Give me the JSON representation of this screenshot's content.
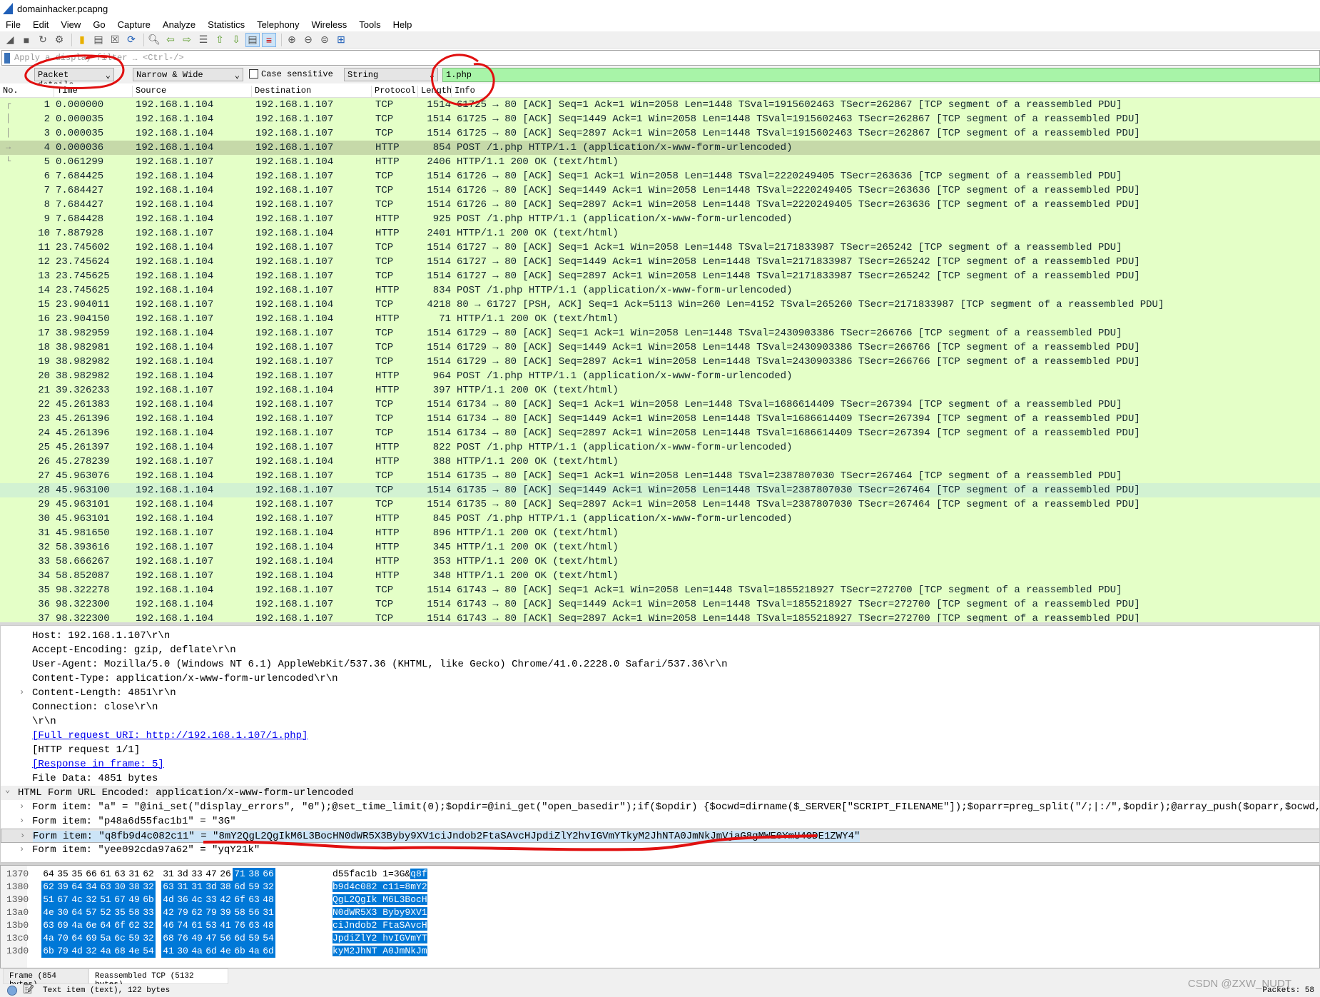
{
  "window": {
    "title": "domainhacker.pcapng"
  },
  "menu": [
    "File",
    "Edit",
    "View",
    "Go",
    "Capture",
    "Analyze",
    "Statistics",
    "Telephony",
    "Wireless",
    "Tools",
    "Help"
  ],
  "toolbar_icons": [
    "shark-fin-start-icon",
    "stop-icon",
    "restart-icon",
    "capture-options-icon",
    "open-file-icon",
    "save-file-icon",
    "close-file-icon",
    "reload-icon",
    "find-packet-icon",
    "go-back-icon",
    "go-forward-icon",
    "go-to-packet-icon",
    "go-first-icon",
    "go-last-icon",
    "autoscroll-icon",
    "colorize-icon",
    "zoom-in-icon",
    "zoom-out-icon",
    "zoom-normal-icon",
    "resize-columns-icon"
  ],
  "filter": {
    "placeholder": "Apply a display filter … <Ctrl-/>"
  },
  "find": {
    "search_in": "Packet details",
    "charset": "Narrow & Wide",
    "case_sensitive_label": "Case sensitive",
    "case_sensitive": false,
    "type": "String",
    "value": "1.php"
  },
  "columns": [
    "No.",
    "Time",
    "Source",
    "Destination",
    "Protocol",
    "Length",
    "Info"
  ],
  "packets": [
    {
      "no": "1",
      "time": "0.000000",
      "src": "192.168.1.104",
      "dst": "192.168.1.107",
      "proto": "TCP",
      "len": "1514",
      "info": "61725 → 80 [ACK] Seq=1 Ack=1 Win=2058 Len=1448 TSval=1915602463 TSecr=262867 [TCP segment of a reassembled PDU]"
    },
    {
      "no": "2",
      "time": "0.000035",
      "src": "192.168.1.104",
      "dst": "192.168.1.107",
      "proto": "TCP",
      "len": "1514",
      "info": "61725 → 80 [ACK] Seq=1449 Ack=1 Win=2058 Len=1448 TSval=1915602463 TSecr=262867 [TCP segment of a reassembled PDU]"
    },
    {
      "no": "3",
      "time": "0.000035",
      "src": "192.168.1.104",
      "dst": "192.168.1.107",
      "proto": "TCP",
      "len": "1514",
      "info": "61725 → 80 [ACK] Seq=2897 Ack=1 Win=2058 Len=1448 TSval=1915602463 TSecr=262867 [TCP segment of a reassembled PDU]"
    },
    {
      "no": "4",
      "time": "0.000036",
      "src": "192.168.1.104",
      "dst": "192.168.1.107",
      "proto": "HTTP",
      "len": "854",
      "info": "POST /1.php HTTP/1.1  (application/x-www-form-urlencoded)",
      "state": "selected"
    },
    {
      "no": "5",
      "time": "0.061299",
      "src": "192.168.1.107",
      "dst": "192.168.1.104",
      "proto": "HTTP",
      "len": "2406",
      "info": "HTTP/1.1 200 OK  (text/html)"
    },
    {
      "no": "6",
      "time": "7.684425",
      "src": "192.168.1.104",
      "dst": "192.168.1.107",
      "proto": "TCP",
      "len": "1514",
      "info": "61726 → 80 [ACK] Seq=1 Ack=1 Win=2058 Len=1448 TSval=2220249405 TSecr=263636 [TCP segment of a reassembled PDU]"
    },
    {
      "no": "7",
      "time": "7.684427",
      "src": "192.168.1.104",
      "dst": "192.168.1.107",
      "proto": "TCP",
      "len": "1514",
      "info": "61726 → 80 [ACK] Seq=1449 Ack=1 Win=2058 Len=1448 TSval=2220249405 TSecr=263636 [TCP segment of a reassembled PDU]"
    },
    {
      "no": "8",
      "time": "7.684427",
      "src": "192.168.1.104",
      "dst": "192.168.1.107",
      "proto": "TCP",
      "len": "1514",
      "info": "61726 → 80 [ACK] Seq=2897 Ack=1 Win=2058 Len=1448 TSval=2220249405 TSecr=263636 [TCP segment of a reassembled PDU]"
    },
    {
      "no": "9",
      "time": "7.684428",
      "src": "192.168.1.104",
      "dst": "192.168.1.107",
      "proto": "HTTP",
      "len": "925",
      "info": "POST /1.php HTTP/1.1  (application/x-www-form-urlencoded)"
    },
    {
      "no": "10",
      "time": "7.887928",
      "src": "192.168.1.107",
      "dst": "192.168.1.104",
      "proto": "HTTP",
      "len": "2401",
      "info": "HTTP/1.1 200 OK  (text/html)"
    },
    {
      "no": "11",
      "time": "23.745602",
      "src": "192.168.1.104",
      "dst": "192.168.1.107",
      "proto": "TCP",
      "len": "1514",
      "info": "61727 → 80 [ACK] Seq=1 Ack=1 Win=2058 Len=1448 TSval=2171833987 TSecr=265242 [TCP segment of a reassembled PDU]"
    },
    {
      "no": "12",
      "time": "23.745624",
      "src": "192.168.1.104",
      "dst": "192.168.1.107",
      "proto": "TCP",
      "len": "1514",
      "info": "61727 → 80 [ACK] Seq=1449 Ack=1 Win=2058 Len=1448 TSval=2171833987 TSecr=265242 [TCP segment of a reassembled PDU]"
    },
    {
      "no": "13",
      "time": "23.745625",
      "src": "192.168.1.104",
      "dst": "192.168.1.107",
      "proto": "TCP",
      "len": "1514",
      "info": "61727 → 80 [ACK] Seq=2897 Ack=1 Win=2058 Len=1448 TSval=2171833987 TSecr=265242 [TCP segment of a reassembled PDU]"
    },
    {
      "no": "14",
      "time": "23.745625",
      "src": "192.168.1.104",
      "dst": "192.168.1.107",
      "proto": "HTTP",
      "len": "834",
      "info": "POST /1.php HTTP/1.1  (application/x-www-form-urlencoded)"
    },
    {
      "no": "15",
      "time": "23.904011",
      "src": "192.168.1.107",
      "dst": "192.168.1.104",
      "proto": "TCP",
      "len": "4218",
      "info": "80 → 61727 [PSH, ACK] Seq=1 Ack=5113 Win=260 Len=4152 TSval=265260 TSecr=2171833987 [TCP segment of a reassembled PDU]"
    },
    {
      "no": "16",
      "time": "23.904150",
      "src": "192.168.1.107",
      "dst": "192.168.1.104",
      "proto": "HTTP",
      "len": "71",
      "info": "HTTP/1.1 200 OK  (text/html)"
    },
    {
      "no": "17",
      "time": "38.982959",
      "src": "192.168.1.104",
      "dst": "192.168.1.107",
      "proto": "TCP",
      "len": "1514",
      "info": "61729 → 80 [ACK] Seq=1 Ack=1 Win=2058 Len=1448 TSval=2430903386 TSecr=266766 [TCP segment of a reassembled PDU]"
    },
    {
      "no": "18",
      "time": "38.982981",
      "src": "192.168.1.104",
      "dst": "192.168.1.107",
      "proto": "TCP",
      "len": "1514",
      "info": "61729 → 80 [ACK] Seq=1449 Ack=1 Win=2058 Len=1448 TSval=2430903386 TSecr=266766 [TCP segment of a reassembled PDU]"
    },
    {
      "no": "19",
      "time": "38.982982",
      "src": "192.168.1.104",
      "dst": "192.168.1.107",
      "proto": "TCP",
      "len": "1514",
      "info": "61729 → 80 [ACK] Seq=2897 Ack=1 Win=2058 Len=1448 TSval=2430903386 TSecr=266766 [TCP segment of a reassembled PDU]"
    },
    {
      "no": "20",
      "time": "38.982982",
      "src": "192.168.1.104",
      "dst": "192.168.1.107",
      "proto": "HTTP",
      "len": "964",
      "info": "POST /1.php HTTP/1.1  (application/x-www-form-urlencoded)"
    },
    {
      "no": "21",
      "time": "39.326233",
      "src": "192.168.1.107",
      "dst": "192.168.1.104",
      "proto": "HTTP",
      "len": "397",
      "info": "HTTP/1.1 200 OK  (text/html)"
    },
    {
      "no": "22",
      "time": "45.261383",
      "src": "192.168.1.104",
      "dst": "192.168.1.107",
      "proto": "TCP",
      "len": "1514",
      "info": "61734 → 80 [ACK] Seq=1 Ack=1 Win=2058 Len=1448 TSval=1686614409 TSecr=267394 [TCP segment of a reassembled PDU]"
    },
    {
      "no": "23",
      "time": "45.261396",
      "src": "192.168.1.104",
      "dst": "192.168.1.107",
      "proto": "TCP",
      "len": "1514",
      "info": "61734 → 80 [ACK] Seq=1449 Ack=1 Win=2058 Len=1448 TSval=1686614409 TSecr=267394 [TCP segment of a reassembled PDU]"
    },
    {
      "no": "24",
      "time": "45.261396",
      "src": "192.168.1.104",
      "dst": "192.168.1.107",
      "proto": "TCP",
      "len": "1514",
      "info": "61734 → 80 [ACK] Seq=2897 Ack=1 Win=2058 Len=1448 TSval=1686614409 TSecr=267394 [TCP segment of a reassembled PDU]"
    },
    {
      "no": "25",
      "time": "45.261397",
      "src": "192.168.1.104",
      "dst": "192.168.1.107",
      "proto": "HTTP",
      "len": "822",
      "info": "POST /1.php HTTP/1.1  (application/x-www-form-urlencoded)"
    },
    {
      "no": "26",
      "time": "45.278239",
      "src": "192.168.1.107",
      "dst": "192.168.1.104",
      "proto": "HTTP",
      "len": "388",
      "info": "HTTP/1.1 200 OK  (text/html)"
    },
    {
      "no": "27",
      "time": "45.963076",
      "src": "192.168.1.104",
      "dst": "192.168.1.107",
      "proto": "TCP",
      "len": "1514",
      "info": "61735 → 80 [ACK] Seq=1 Ack=1 Win=2058 Len=1448 TSval=2387807030 TSecr=267464 [TCP segment of a reassembled PDU]"
    },
    {
      "no": "28",
      "time": "45.963100",
      "src": "192.168.1.104",
      "dst": "192.168.1.107",
      "proto": "TCP",
      "len": "1514",
      "info": "61735 → 80 [ACK] Seq=1449 Ack=1 Win=2058 Len=1448 TSval=2387807030 TSecr=267464 [TCP segment of a reassembled PDU]",
      "state": "hover"
    },
    {
      "no": "29",
      "time": "45.963101",
      "src": "192.168.1.104",
      "dst": "192.168.1.107",
      "proto": "TCP",
      "len": "1514",
      "info": "61735 → 80 [ACK] Seq=2897 Ack=1 Win=2058 Len=1448 TSval=2387807030 TSecr=267464 [TCP segment of a reassembled PDU]"
    },
    {
      "no": "30",
      "time": "45.963101",
      "src": "192.168.1.104",
      "dst": "192.168.1.107",
      "proto": "HTTP",
      "len": "845",
      "info": "POST /1.php HTTP/1.1  (application/x-www-form-urlencoded)"
    },
    {
      "no": "31",
      "time": "45.981650",
      "src": "192.168.1.107",
      "dst": "192.168.1.104",
      "proto": "HTTP",
      "len": "896",
      "info": "HTTP/1.1 200 OK  (text/html)"
    },
    {
      "no": "32",
      "time": "58.393616",
      "src": "192.168.1.107",
      "dst": "192.168.1.104",
      "proto": "HTTP",
      "len": "345",
      "info": "HTTP/1.1 200 OK  (text/html)"
    },
    {
      "no": "33",
      "time": "58.666267",
      "src": "192.168.1.107",
      "dst": "192.168.1.104",
      "proto": "HTTP",
      "len": "353",
      "info": "HTTP/1.1 200 OK  (text/html)"
    },
    {
      "no": "34",
      "time": "58.852087",
      "src": "192.168.1.107",
      "dst": "192.168.1.104",
      "proto": "HTTP",
      "len": "348",
      "info": "HTTP/1.1 200 OK  (text/html)"
    },
    {
      "no": "35",
      "time": "98.322278",
      "src": "192.168.1.104",
      "dst": "192.168.1.107",
      "proto": "TCP",
      "len": "1514",
      "info": "61743 → 80 [ACK] Seq=1 Ack=1 Win=2058 Len=1448 TSval=1855218927 TSecr=272700 [TCP segment of a reassembled PDU]"
    },
    {
      "no": "36",
      "time": "98.322300",
      "src": "192.168.1.104",
      "dst": "192.168.1.107",
      "proto": "TCP",
      "len": "1514",
      "info": "61743 → 80 [ACK] Seq=1449 Ack=1 Win=2058 Len=1448 TSval=1855218927 TSecr=272700 [TCP segment of a reassembled PDU]"
    },
    {
      "no": "37",
      "time": "98.322300",
      "src": "192.168.1.104",
      "dst": "192.168.1.107",
      "proto": "TCP",
      "len": "1514",
      "info": "61743 → 80 [ACK] Seq=2897 Ack=1 Win=2058 Len=1448 TSval=1855218927 TSecr=272700 [TCP segment of a reassembled PDU]"
    }
  ],
  "details": [
    {
      "text": "Host: 192.168.1.107\\r\\n",
      "indent": 1
    },
    {
      "text": "Accept-Encoding: gzip, deflate\\r\\n",
      "indent": 1
    },
    {
      "text": "User-Agent: Mozilla/5.0 (Windows NT 6.1) AppleWebKit/537.36 (KHTML, like Gecko) Chrome/41.0.2228.0 Safari/537.36\\r\\n",
      "indent": 1
    },
    {
      "text": "Content-Type: application/x-www-form-urlencoded\\r\\n",
      "indent": 1
    },
    {
      "text": "Content-Length: 4851\\r\\n",
      "indent": 1,
      "expander": "collapsed"
    },
    {
      "text": "Connection: close\\r\\n",
      "indent": 1
    },
    {
      "text": "\\r\\n",
      "indent": 1
    },
    {
      "text": "[Full request URI: http://192.168.1.107/1.php]",
      "indent": 1,
      "link": true
    },
    {
      "text": "[HTTP request 1/1]",
      "indent": 1
    },
    {
      "text": "[Response in frame: 5]",
      "indent": 1,
      "link": true
    },
    {
      "text": "File Data: 4851 bytes",
      "indent": 1
    },
    {
      "text": "HTML Form URL Encoded: application/x-www-form-urlencoded",
      "indent": 0,
      "expander": "expanded",
      "group": true
    },
    {
      "text": "Form item: \"a\" = \"@ini_set(\"display_errors\", \"0\");@set_time_limit(0);$opdir=@ini_get(\"open_basedir\");if($opdir) {$ocwd=dirname($_SERVER[\"SCRIPT_FILENAME\"]);$oparr=preg_split(\"/;|:/\",$opdir);@array_push($oparr,$ocwd,sys_get_tem",
      "indent": 1,
      "expander": "collapsed"
    },
    {
      "text": "Form item: \"p48a6d55fac1b1\" = \"3G\"",
      "indent": 1,
      "expander": "collapsed"
    },
    {
      "text": "Form item: \"q8fb9d4c082c11\" = \"8mY2QgL2QgIkM6L3BocHN0dWR5X3Byby9XV1ciJndob2FtaSAvcHJpdiZlY2hvIGVmYTkyM2JhNTA0JmNkJmVjaG8gMWE0YmU4ODE1ZWY4\"",
      "indent": 1,
      "expander": "collapsed",
      "selected": true
    },
    {
      "text": "Form item: \"yee092cda97a62\" = \"yqY21k\"",
      "indent": 1,
      "expander": "collapsed"
    }
  ],
  "hex": [
    {
      "offset": "1370",
      "bytes": [
        "64",
        "35",
        "35",
        "66",
        "61",
        "63",
        "31",
        "62",
        "31",
        "3d",
        "33",
        "47",
        "26",
        "71",
        "38",
        "66"
      ],
      "ascii": "d55fac1b 1=3G&q8f",
      "hl_from": 13
    },
    {
      "offset": "1380",
      "bytes": [
        "62",
        "39",
        "64",
        "34",
        "63",
        "30",
        "38",
        "32",
        "63",
        "31",
        "31",
        "3d",
        "38",
        "6d",
        "59",
        "32"
      ],
      "ascii": "b9d4c082 c11=8mY2",
      "hl_from": 0
    },
    {
      "offset": "1390",
      "bytes": [
        "51",
        "67",
        "4c",
        "32",
        "51",
        "67",
        "49",
        "6b",
        "4d",
        "36",
        "4c",
        "33",
        "42",
        "6f",
        "63",
        "48"
      ],
      "ascii": "QgL2QgIk M6L3BocH",
      "hl_from": 0
    },
    {
      "offset": "13a0",
      "bytes": [
        "4e",
        "30",
        "64",
        "57",
        "52",
        "35",
        "58",
        "33",
        "42",
        "79",
        "62",
        "79",
        "39",
        "58",
        "56",
        "31"
      ],
      "ascii": "N0dWR5X3 Byby9XV1",
      "hl_from": 0
    },
    {
      "offset": "13b0",
      "bytes": [
        "63",
        "69",
        "4a",
        "6e",
        "64",
        "6f",
        "62",
        "32",
        "46",
        "74",
        "61",
        "53",
        "41",
        "76",
        "63",
        "48"
      ],
      "ascii": "ciJndob2 FtaSAvcH",
      "hl_from": 0
    },
    {
      "offset": "13c0",
      "bytes": [
        "4a",
        "70",
        "64",
        "69",
        "5a",
        "6c",
        "59",
        "32",
        "68",
        "76",
        "49",
        "47",
        "56",
        "6d",
        "59",
        "54"
      ],
      "ascii": "JpdiZlY2 hvIGVmYT",
      "hl_from": 0
    },
    {
      "offset": "13d0",
      "bytes": [
        "6b",
        "79",
        "4d",
        "32",
        "4a",
        "68",
        "4e",
        "54",
        "41",
        "30",
        "4a",
        "6d",
        "4e",
        "6b",
        "4a",
        "6d"
      ],
      "ascii": "kyM2JhNT A0JmNkJm",
      "hl_from": 0
    }
  ],
  "byte_tabs": [
    {
      "label": "Frame (854 bytes)",
      "active": false
    },
    {
      "label": "Reassembled TCP (5132 bytes)",
      "active": true
    }
  ],
  "status": {
    "text": "Text item (text), 122 bytes",
    "packets": "Packets: 58"
  },
  "watermark": "CSDN @ZXW_NUDT",
  "colors": {
    "row_bg": "#e4ffc7",
    "selected_row": "#c6d9a9",
    "byte_highlight": "#0078d7",
    "find_ok": "#a8f4a8",
    "annotation": "#e01010"
  }
}
